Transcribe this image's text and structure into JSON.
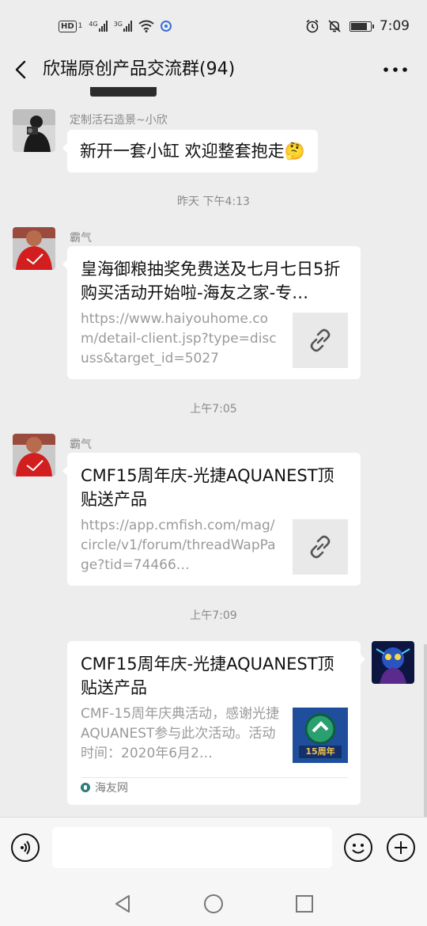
{
  "status_bar": {
    "hd_label": "HD",
    "sim1_label": "1",
    "net1_label": "4G",
    "net2_label": "3G",
    "time": "7:09",
    "icons": [
      "alarm-icon",
      "mute-bell-icon",
      "battery-icon",
      "wifi-icon",
      "sim-icon"
    ]
  },
  "title_bar": {
    "title": "欣瑞原创产品交流群(94)"
  },
  "messages": {
    "m1": {
      "sender": "定制活石造景~小欣",
      "text": "新开一套小缸 欢迎整套抱走🤔"
    },
    "t1": "昨天 下午4:13",
    "m2": {
      "sender": "霸气",
      "title": "皇海御粮抽奖免费送及七月七日5折购买活动开始啦-海友之家-专…",
      "url": "https://www.haiyouhome.com/detail-client.jsp?type=discuss&target_id=5027"
    },
    "t2": "上午7:05",
    "m3": {
      "sender": "霸气",
      "title": "CMF15周年庆-光捷AQUANEST顶贴送产品",
      "url": "https://app.cmfish.com/mag/circle/v1/forum/threadWapPage?tid=74466…"
    },
    "t3": "上午7:09",
    "m4": {
      "title": "CMF15周年庆-光捷AQUANEST顶贴送产品",
      "desc": "CMF-15周年庆典活动，感谢光捷AQUANEST参与此次活动。活动时间：2020年6月2…",
      "thumb_text": "15周年",
      "source": "海友网"
    }
  },
  "input_bar": {
    "placeholder": ""
  },
  "colors": {
    "background": "#ededed",
    "bubble": "#ffffff",
    "meta_text": "#8a8a8a",
    "source_icon": "#2f7c7a"
  }
}
